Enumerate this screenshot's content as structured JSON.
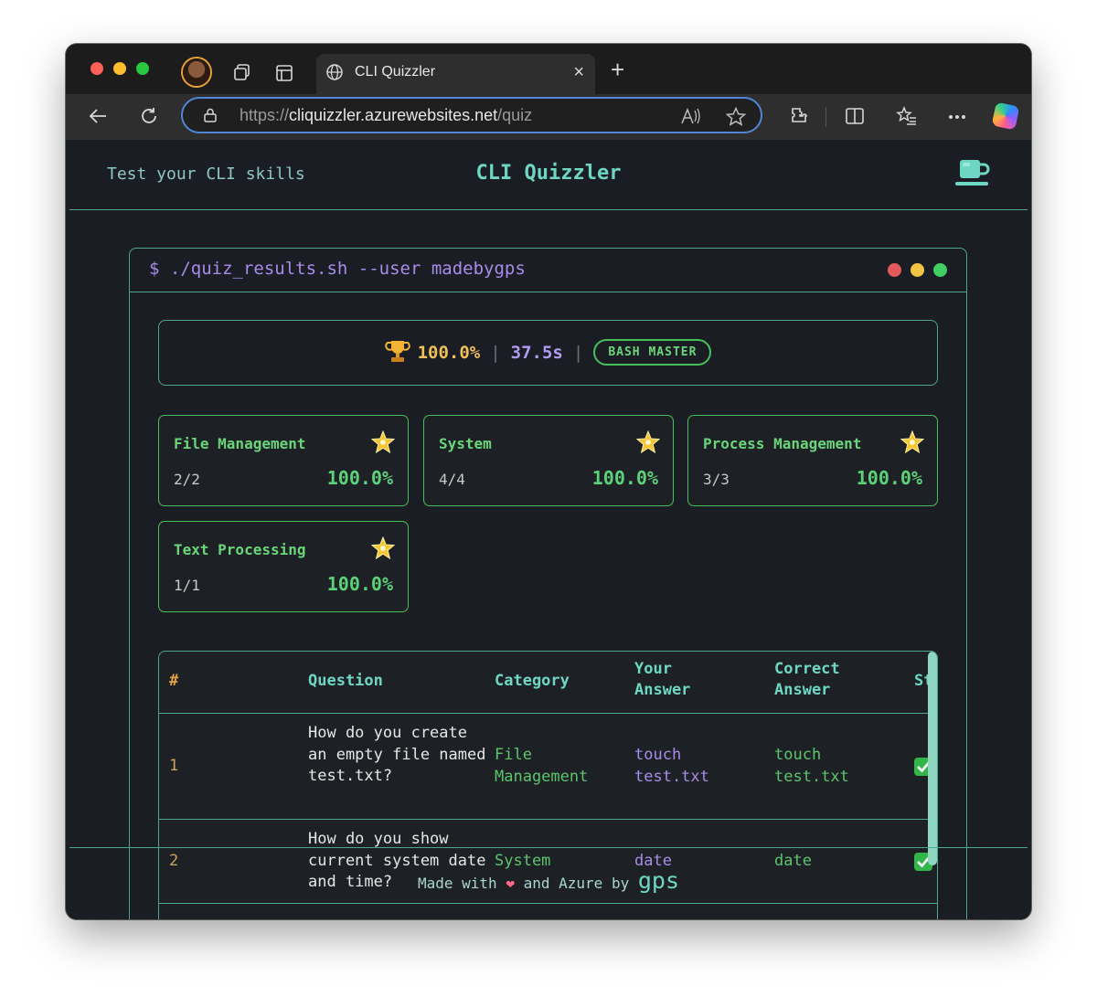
{
  "browser": {
    "tab_title": "CLI Quizzler",
    "url_scheme": "https://",
    "url_host": "cliquizzler.azurewebsites.net",
    "url_path": "/quiz",
    "new_tab_symbol": "+",
    "tab_close_symbol": "×"
  },
  "header": {
    "tagline": "Test your CLI skills",
    "title": "CLI Quizzler",
    "icon": "coffee-cup-icon"
  },
  "terminal": {
    "command": "$ ./quiz_results.sh --user madebygps",
    "summary": {
      "score": "100.0%",
      "separator": "|",
      "time": "37.5s",
      "badge": "BASH MASTER"
    }
  },
  "categories": [
    {
      "name": "File Management",
      "count": "2/2",
      "percent": "100.0%"
    },
    {
      "name": "System",
      "count": "4/4",
      "percent": "100.0%"
    },
    {
      "name": "Process Management",
      "count": "3/3",
      "percent": "100.0%"
    },
    {
      "name": "Text Processing",
      "count": "1/1",
      "percent": "100.0%"
    }
  ],
  "table": {
    "headers": {
      "index": "#",
      "question": "Question",
      "category": "Category",
      "your_answer": "Your Answer",
      "correct_answer": "Correct Answer",
      "status": "St"
    },
    "rows": [
      {
        "index": "1",
        "question": "How do you create an empty file named test.txt?",
        "category": "File Management",
        "your_answer": "touch test.txt",
        "correct_answer": "touch test.txt",
        "status": "correct"
      },
      {
        "index": "2",
        "question": "How do you show current system date and time?",
        "category": "System",
        "your_answer": "date",
        "correct_answer": "date",
        "status": "correct"
      }
    ]
  },
  "footer": {
    "prefix": "Made with",
    "middle": "and Azure by",
    "author": "gps"
  },
  "colors": {
    "accent_teal": "#6ed7c3",
    "accent_green": "#46c05a",
    "accent_purple": "#a88ce8",
    "accent_gold": "#f0c05a",
    "background": "#1b1d24"
  }
}
